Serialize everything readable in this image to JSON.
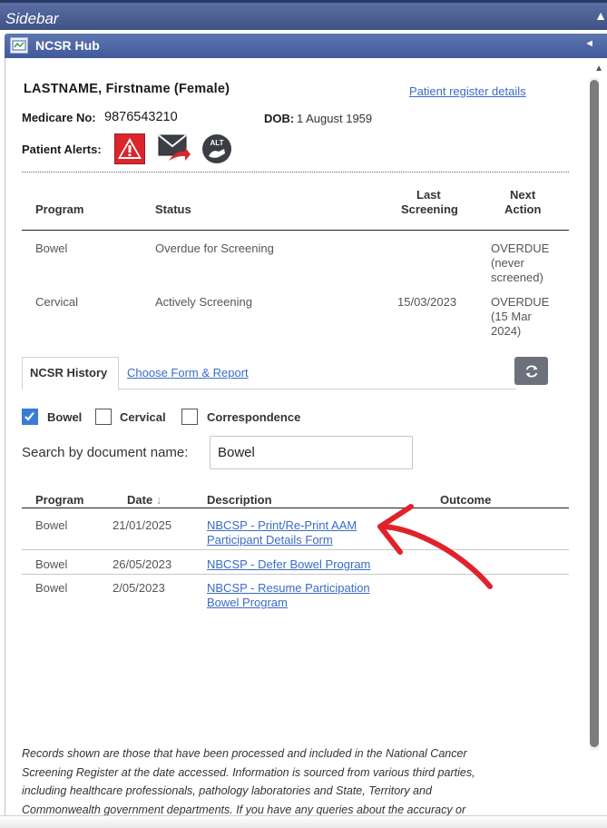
{
  "sidebar": {
    "title": "Sidebar"
  },
  "hub": {
    "title": "NCSR Hub",
    "collapse_arrow": "◄"
  },
  "patient": {
    "name": "LASTNAME, Firstname (Female)",
    "register_link": "Patient register details",
    "medicare_label": "Medicare No:",
    "medicare_no": "9876543210",
    "dob_label": "DOB:",
    "dob": "1 August 1959",
    "alerts_label": "Patient Alerts:",
    "alert_icons": [
      "warning-icon",
      "mail-forward-icon",
      "alt-contact-icon"
    ]
  },
  "programs": {
    "headers": {
      "program": "Program",
      "status": "Status",
      "last_line1": "Last",
      "last_line2": "Screening",
      "next_line1": "Next",
      "next_line2": "Action"
    },
    "rows": [
      {
        "program": "Bowel",
        "status": "Overdue for Screening",
        "last": "",
        "next": [
          "OVERDUE",
          "(never",
          "screened)"
        ]
      },
      {
        "program": "Cervical",
        "status": "Actively Screening",
        "last": "15/03/2023",
        "next": [
          "OVERDUE",
          "(15 Mar",
          "2024)"
        ]
      }
    ]
  },
  "tabs": {
    "active": "NCSR History",
    "other": "Choose Form & Report"
  },
  "filters": {
    "bowel": {
      "label": "Bowel",
      "checked": true
    },
    "cervical": {
      "label": "Cervical",
      "checked": false
    },
    "correspondence": {
      "label": "Correspondence",
      "checked": false
    }
  },
  "search": {
    "label": "Search by document name:",
    "value": "Bowel"
  },
  "history": {
    "headers": {
      "program": "Program",
      "date": "Date",
      "sort_arrow": "↓",
      "description": "Description",
      "outcome": "Outcome"
    },
    "rows": [
      {
        "program": "Bowel",
        "date": "21/01/2025",
        "description": [
          "NBCSP - Print/Re-Print AAM",
          "Participant Details Form"
        ],
        "outcome": ""
      },
      {
        "program": "Bowel",
        "date": "26/05/2023",
        "description": [
          "NBCSP - Defer Bowel Program"
        ],
        "outcome": ""
      },
      {
        "program": "Bowel",
        "date": "2/05/2023",
        "description": [
          "NBCSP - Resume Participation",
          "Bowel Program"
        ],
        "outcome": ""
      }
    ]
  },
  "footer": {
    "lines": [
      "Records shown are those that have been processed and included in the National Cancer",
      "Screening Register at the date accessed. Information is sourced from various third parties,",
      "including healthcare professionals, pathology laboratories and State, Territory and",
      "Commonwealth government departments. If you have any queries about the accuracy or"
    ]
  },
  "colors": {
    "accent": "#3a6bc7",
    "header_bar": "#4a62a0",
    "annotation_arrow": "#e0222c",
    "alert_red": "#d9262c"
  }
}
